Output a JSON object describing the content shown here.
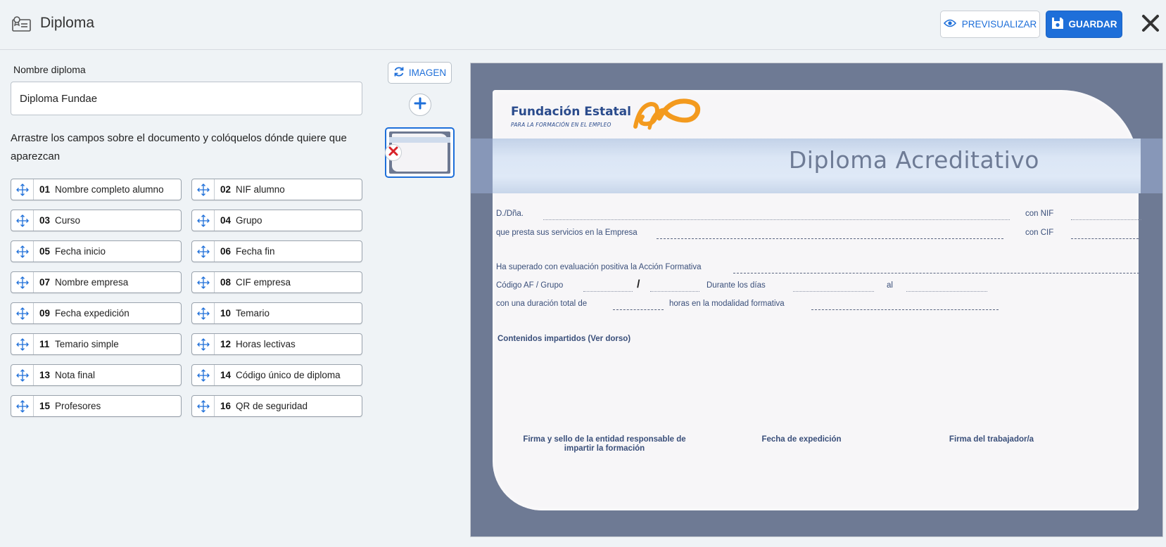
{
  "header": {
    "title": "Diploma",
    "preview_label": "PREVISUALIZAR",
    "save_label": "GUARDAR"
  },
  "form": {
    "name_label": "Nombre diploma",
    "name_value": "Diploma Fundae",
    "instructions": "Arrastre los campos sobre el documento y colóquelos dónde quiere que aparezcan"
  },
  "fields": [
    {
      "num": "01",
      "label": "Nombre completo alumno"
    },
    {
      "num": "02",
      "label": "NIF alumno"
    },
    {
      "num": "03",
      "label": "Curso"
    },
    {
      "num": "04",
      "label": "Grupo"
    },
    {
      "num": "05",
      "label": "Fecha inicio"
    },
    {
      "num": "06",
      "label": "Fecha fin"
    },
    {
      "num": "07",
      "label": "Nombre empresa"
    },
    {
      "num": "08",
      "label": "CIF empresa"
    },
    {
      "num": "09",
      "label": "Fecha expedición"
    },
    {
      "num": "10",
      "label": "Temario"
    },
    {
      "num": "11",
      "label": "Temario simple"
    },
    {
      "num": "12",
      "label": "Horas lectivas"
    },
    {
      "num": "13",
      "label": "Nota final"
    },
    {
      "num": "14",
      "label": "Código único de diploma"
    },
    {
      "num": "15",
      "label": "Profesores"
    },
    {
      "num": "16",
      "label": "QR de seguridad"
    }
  ],
  "images": {
    "image_button_label": "IMAGEN"
  },
  "diploma": {
    "org_name": "Fundación Estatal",
    "org_subtitle": "PARA LA FORMACIÓN EN EL EMPLEO",
    "title": "Diploma Acreditativo",
    "line_dna": "D./Dña.",
    "line_con_nif": "con NIF",
    "line_empresa": "que presta sus servicios en la Empresa",
    "line_con_cif": "con CIF",
    "line_accion": "Ha superado con evaluación positiva la Acción Formativa",
    "line_codigo": "Código AF / Grupo",
    "slash": "/",
    "line_durante": "Durante los días",
    "line_al": "al",
    "line_duracion": "con una duración total de",
    "line_horas": "horas en la modalidad formativa",
    "contenidos": "Contenidos impartidos (Ver dorso)",
    "firma_entidad_1": "Firma y sello de la entidad responsable de",
    "firma_entidad_2": "impartir la formación",
    "fecha_expedicion": "Fecha de expedición",
    "firma_trabajador": "Firma del trabajador/a"
  },
  "colors": {
    "accent": "#1e6fd9",
    "diploma_frame": "#6e7a94",
    "diploma_text": "#3a4f7a",
    "logo_orange": "#f39a1e"
  }
}
